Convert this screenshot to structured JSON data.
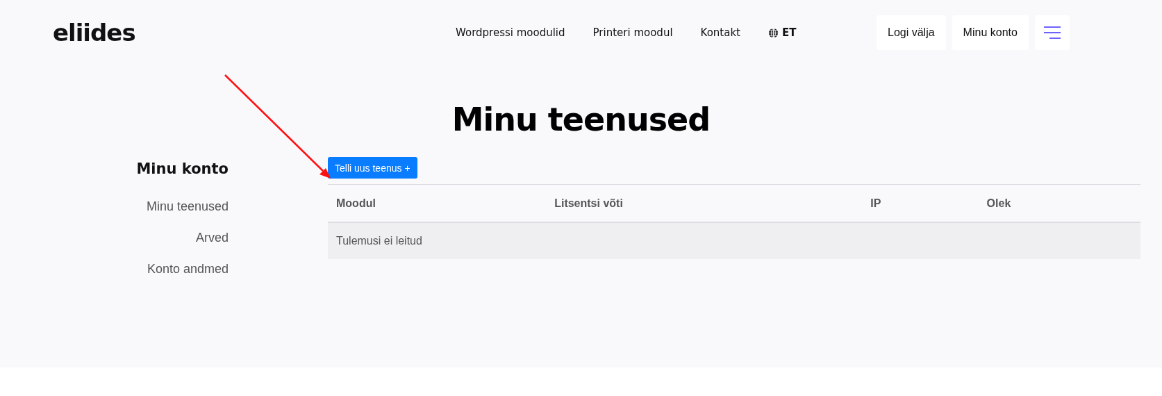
{
  "header": {
    "logo": "eliides",
    "nav": [
      {
        "label": "Wordpressi moodulid",
        "kind": "link"
      },
      {
        "label": "Printeri moodul",
        "kind": "link"
      },
      {
        "label": "Kontakt",
        "kind": "link"
      },
      {
        "label": "ET",
        "kind": "language"
      }
    ],
    "buttons": [
      "Logi välja",
      "Minu konto"
    ]
  },
  "page_title": "Minu teenused",
  "sidebar": {
    "title": "Minu konto",
    "items": [
      "Minu teenused",
      "Arved",
      "Konto andmed"
    ]
  },
  "order_button": "Telli uus teenus +",
  "table": {
    "columns": [
      "Moodul",
      "Litsentsi võti",
      "IP",
      "Olek"
    ],
    "empty_message": "Tulemusi ei leitud"
  }
}
